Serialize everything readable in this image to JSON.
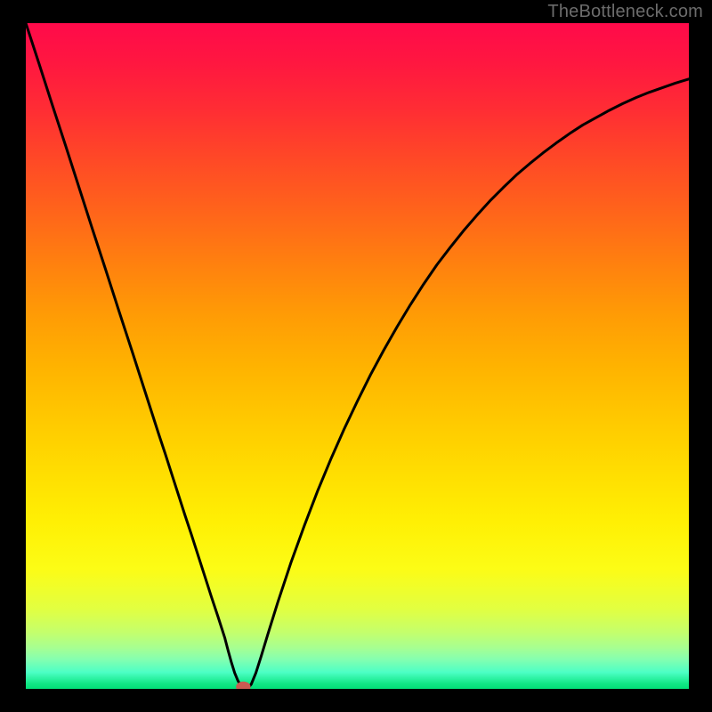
{
  "watermark": "TheBottleneck.com",
  "chart_data": {
    "type": "line",
    "title": "",
    "xlabel": "",
    "ylabel": "",
    "xlim": [
      0,
      1
    ],
    "ylim": [
      0,
      1
    ],
    "background_gradient": {
      "stops": [
        {
          "offset": 0.0,
          "color": "#ff0a4a"
        },
        {
          "offset": 0.06,
          "color": "#ff1740"
        },
        {
          "offset": 0.13,
          "color": "#ff2d34"
        },
        {
          "offset": 0.2,
          "color": "#ff4727"
        },
        {
          "offset": 0.28,
          "color": "#ff631b"
        },
        {
          "offset": 0.36,
          "color": "#ff800f"
        },
        {
          "offset": 0.44,
          "color": "#ff9c05"
        },
        {
          "offset": 0.52,
          "color": "#ffb400"
        },
        {
          "offset": 0.6,
          "color": "#ffca00"
        },
        {
          "offset": 0.68,
          "color": "#ffdf01"
        },
        {
          "offset": 0.75,
          "color": "#fff004"
        },
        {
          "offset": 0.82,
          "color": "#fcfc16"
        },
        {
          "offset": 0.88,
          "color": "#e2ff41"
        },
        {
          "offset": 0.915,
          "color": "#c4ff6c"
        },
        {
          "offset": 0.938,
          "color": "#a7ff91"
        },
        {
          "offset": 0.955,
          "color": "#86ffaf"
        },
        {
          "offset": 0.975,
          "color": "#4dffc5"
        },
        {
          "offset": 0.993,
          "color": "#0fe683"
        },
        {
          "offset": 1.0,
          "color": "#03df78"
        }
      ]
    },
    "series": [
      {
        "name": "bottleneck-curve",
        "stroke": "#000000",
        "stroke_width": 3,
        "points": [
          [
            0.0,
            1.0
          ],
          [
            0.02,
            0.939
          ],
          [
            0.04,
            0.877
          ],
          [
            0.06,
            0.816
          ],
          [
            0.08,
            0.754
          ],
          [
            0.1,
            0.692
          ],
          [
            0.12,
            0.631
          ],
          [
            0.14,
            0.569
          ],
          [
            0.16,
            0.508
          ],
          [
            0.18,
            0.446
          ],
          [
            0.2,
            0.384
          ],
          [
            0.21,
            0.354
          ],
          [
            0.22,
            0.323
          ],
          [
            0.23,
            0.292
          ],
          [
            0.24,
            0.261
          ],
          [
            0.25,
            0.231
          ],
          [
            0.26,
            0.2
          ],
          [
            0.27,
            0.169
          ],
          [
            0.28,
            0.138
          ],
          [
            0.29,
            0.108
          ],
          [
            0.3,
            0.077
          ],
          [
            0.305,
            0.058
          ],
          [
            0.31,
            0.04
          ],
          [
            0.315,
            0.024
          ],
          [
            0.32,
            0.012
          ],
          [
            0.325,
            0.004
          ],
          [
            0.33,
            0.0
          ],
          [
            0.335,
            0.001
          ],
          [
            0.34,
            0.007
          ],
          [
            0.347,
            0.024
          ],
          [
            0.355,
            0.049
          ],
          [
            0.365,
            0.082
          ],
          [
            0.38,
            0.13
          ],
          [
            0.4,
            0.19
          ],
          [
            0.42,
            0.245
          ],
          [
            0.44,
            0.297
          ],
          [
            0.46,
            0.345
          ],
          [
            0.48,
            0.39
          ],
          [
            0.5,
            0.432
          ],
          [
            0.52,
            0.472
          ],
          [
            0.54,
            0.509
          ],
          [
            0.56,
            0.544
          ],
          [
            0.58,
            0.577
          ],
          [
            0.6,
            0.608
          ],
          [
            0.62,
            0.637
          ],
          [
            0.64,
            0.663
          ],
          [
            0.66,
            0.688
          ],
          [
            0.68,
            0.711
          ],
          [
            0.7,
            0.733
          ],
          [
            0.72,
            0.753
          ],
          [
            0.74,
            0.772
          ],
          [
            0.76,
            0.789
          ],
          [
            0.78,
            0.805
          ],
          [
            0.8,
            0.82
          ],
          [
            0.82,
            0.834
          ],
          [
            0.84,
            0.847
          ],
          [
            0.86,
            0.858
          ],
          [
            0.88,
            0.869
          ],
          [
            0.9,
            0.879
          ],
          [
            0.92,
            0.888
          ],
          [
            0.94,
            0.896
          ],
          [
            0.96,
            0.903
          ],
          [
            0.98,
            0.91
          ],
          [
            1.0,
            0.916
          ]
        ]
      }
    ],
    "markers": [
      {
        "name": "minimum-marker",
        "x": 0.328,
        "y": 0.003,
        "rx": 0.011,
        "ry": 0.008,
        "fill": "#ca5a52"
      }
    ]
  }
}
